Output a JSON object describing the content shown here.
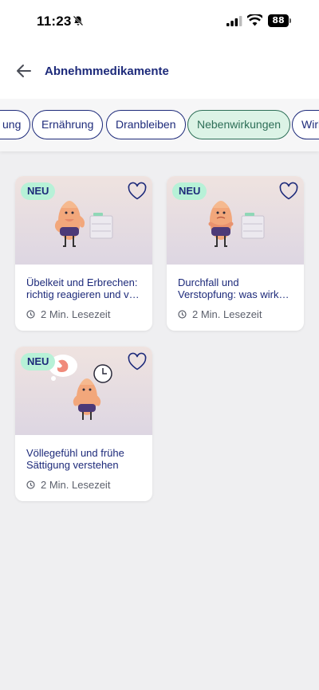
{
  "status_bar": {
    "time": "11:23",
    "battery": "88"
  },
  "header": {
    "title": "Abnehmmedikamente"
  },
  "chips": [
    {
      "label": "ung"
    },
    {
      "label": "Ernährung"
    },
    {
      "label": "Dranbleiben"
    },
    {
      "label": "Nebenwirkungen",
      "active": true
    },
    {
      "label": "Wirk"
    }
  ],
  "cards": [
    {
      "badge": "NEU",
      "title": "Übelkeit und Erbrechen: richtig reagieren und v…",
      "reading_time": "2 Min. Lesezeit"
    },
    {
      "badge": "NEU",
      "title": "Durchfall und Verstopfung: was wirk…",
      "reading_time": "2 Min. Lesezeit"
    },
    {
      "badge": "NEU",
      "title": "Völlegefühl und frühe Sättigung verstehen",
      "reading_time": "2 Min. Lesezeit"
    }
  ],
  "colors": {
    "accent": "#1d2a7a",
    "badge": "#b7f1d7",
    "active_chip": "#dcf3e6"
  }
}
